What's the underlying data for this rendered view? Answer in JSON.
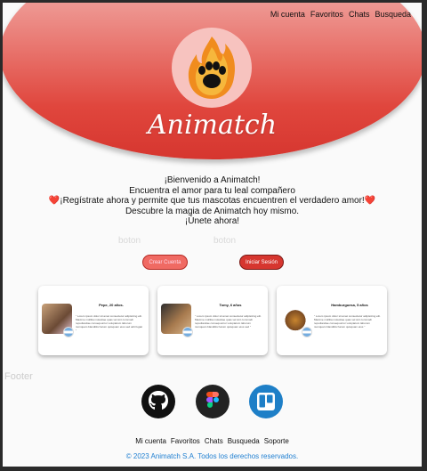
{
  "nav": {
    "items": [
      "Mi cuenta",
      "Favoritos",
      "Chats",
      "Busqueda"
    ]
  },
  "brand": {
    "name": "Animatch"
  },
  "welcome": {
    "line1": "¡Bienvenido a Animatch!",
    "line2": "Encuentra el amor para tu leal compañero",
    "line3_pre": "❤️",
    "line3": "¡Regístrate ahora y permite que tus mascotas encuentren el verdadero amor!",
    "line3_post": "❤️",
    "line4": "Descubre la magia de Animatch hoy mismo.",
    "line5": "¡Únete ahora!"
  },
  "buttons": {
    "caption_left": "boton",
    "caption_right": "boton",
    "create": "Crear Cuenta",
    "login": "Iniciar Sesión"
  },
  "cards": [
    {
      "name": "Pepe, 20 años.",
      "quote": "\" Lorem ipsum dolor sit amet consectetur adipisicing elit. Maxime mollitia molestiae quas vel sint commodi repudiandae consequuntur voluptatum laborum numquam blanditiis harum quisquam eius sed odit fugiat \""
    },
    {
      "name": "Tomy, 6 años",
      "quote": "\" Lorem ipsum dolor sit amet consectetur adipisicing elit. Maxime mollitia molestiae quas vel sint commodi repudiandae consequuntur voluptatum laborum numquam blanditiis harum quisquam eius sed \""
    },
    {
      "name": "Hamburguesa, 5 años",
      "quote": "\" Lorem ipsum dolor sit amet consectetur adipisicing elit. Maxime mollitia molestiae quas vel sint commodi repudiandae consequuntur voluptatum laborum numquam blanditiis harum quisquam eius \""
    }
  ],
  "footer": {
    "label": "Footer",
    "links": [
      "Mi cuenta",
      "Favoritos",
      "Chats",
      "Busqueda",
      "Soporte"
    ],
    "copyright": "© 2023 Animatch S.A. Todos los derechos reservados."
  },
  "colors": {
    "accent": "#d6362f",
    "link": "#1f7fd1",
    "flame": "#f39c12"
  },
  "icons": [
    "paw-flame-logo-icon",
    "github-icon",
    "figma-icon",
    "trello-icon",
    "argentina-flag-icon"
  ]
}
